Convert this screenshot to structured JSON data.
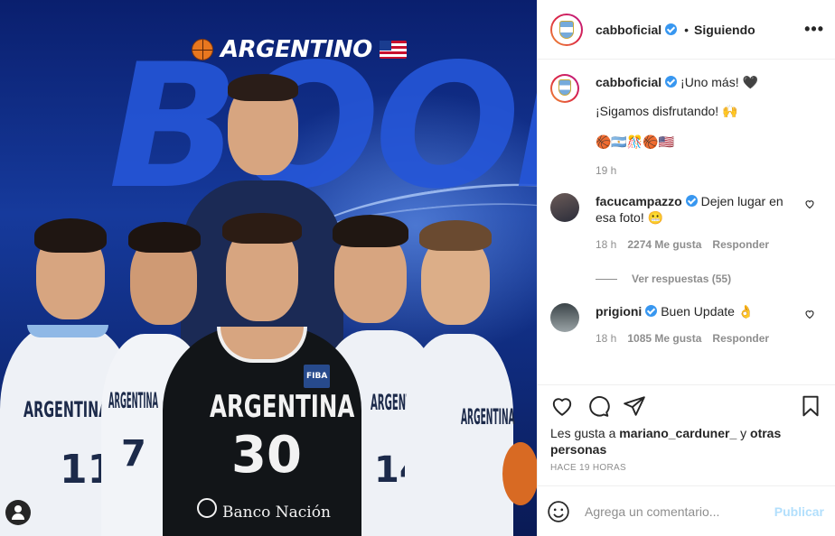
{
  "post_image": {
    "brand_text": "ARGENTINO",
    "background_word": "BOOM",
    "jersey_country": "ARGENTINA",
    "center_number": "30",
    "left_number": "11",
    "second_number": "7",
    "fourth_number": "14",
    "sponsor": "Banco Nación",
    "fiba_badge": "FIBA"
  },
  "header": {
    "username": "cabboficial",
    "separator": "•",
    "follow_status": "Siguiendo",
    "more_icon": "more-horizontal-icon"
  },
  "caption": {
    "username": "cabboficial",
    "line1": "¡Uno más! 🖤",
    "line2": "¡Sigamos disfrutando! 🙌",
    "line3": "🏀🇦🇷🎊🏀🇺🇸",
    "time": "19 h"
  },
  "comments": [
    {
      "username": "facucampazzo",
      "text": "Dejen lugar en esa foto! 😬",
      "time": "18 h",
      "likes": "2274 Me gusta",
      "reply": "Responder",
      "view_replies": "Ver respuestas (55)"
    },
    {
      "username": "prigioni",
      "text": "Buen Update 👌",
      "time": "18 h",
      "likes": "1085 Me gusta",
      "reply": "Responder"
    }
  ],
  "actions": {
    "likes_prefix": "Les gusta a",
    "likes_user": "mariano_carduner_",
    "likes_and": "y",
    "likes_others": "otras personas",
    "timestamp": "HACE 19 HORAS"
  },
  "add_comment": {
    "placeholder": "Agrega un comentario...",
    "publish": "Publicar"
  },
  "colors": {
    "verified": "#3897f0",
    "publish_disabled": "#b2dffc",
    "muted": "#8e8e8e"
  }
}
